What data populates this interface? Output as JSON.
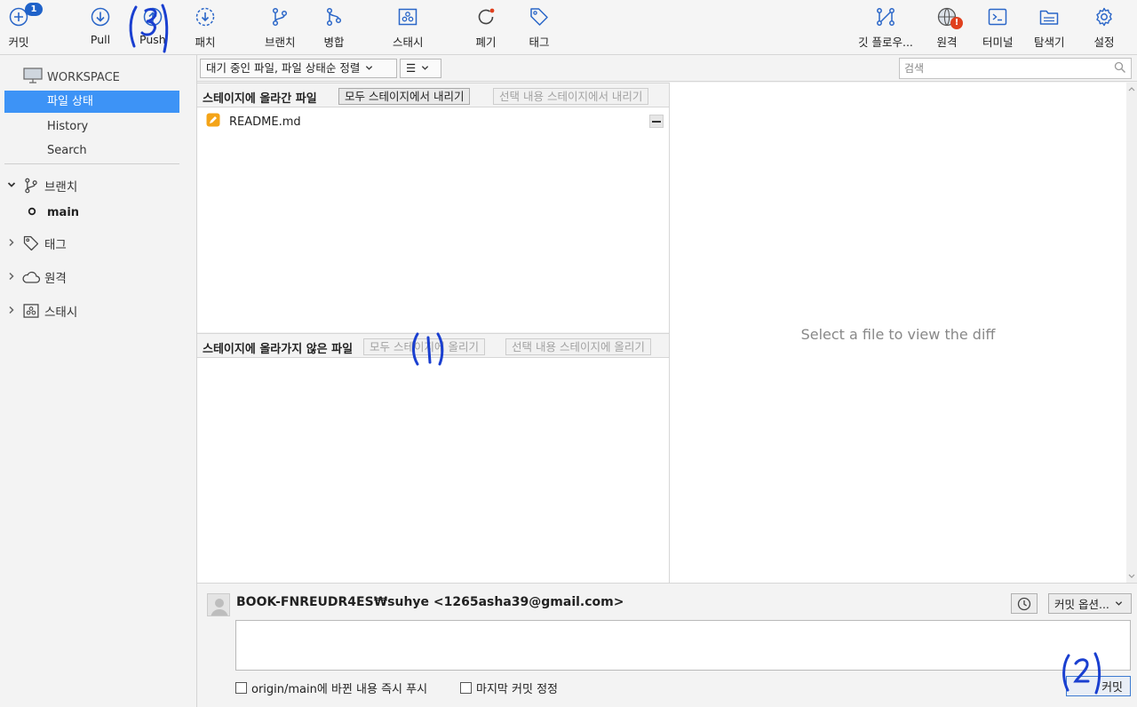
{
  "toolbar": {
    "commit": {
      "label": "커밋",
      "badge": "1"
    },
    "pull": {
      "label": "Pull"
    },
    "push": {
      "label": "Push"
    },
    "fetch": {
      "label": "패치"
    },
    "branch": {
      "label": "브랜치"
    },
    "merge": {
      "label": "병합"
    },
    "stash": {
      "label": "스태시"
    },
    "discard": {
      "label": "폐기"
    },
    "tag": {
      "label": "태그"
    },
    "gitflow": {
      "label": "깃 플로우..."
    },
    "remote": {
      "label": "원격",
      "warning": "!"
    },
    "terminal": {
      "label": "터미널"
    },
    "explorer": {
      "label": "탐색기"
    },
    "settings": {
      "label": "설정"
    }
  },
  "sidebar": {
    "workspace": "WORKSPACE",
    "items": [
      {
        "label": "파일 상태"
      },
      {
        "label": "History"
      },
      {
        "label": "Search"
      }
    ],
    "branches": {
      "label": "브랜치",
      "current": "main"
    },
    "tags": {
      "label": "태그"
    },
    "remotes": {
      "label": "원격"
    },
    "stashes": {
      "label": "스태시"
    }
  },
  "filter": {
    "status_dropdown": "대기 중인 파일, 파일 상태순 정렬",
    "view_dropdown": "☰",
    "search_placeholder": "검색"
  },
  "staged": {
    "title": "스테이지에 올라간 파일",
    "unstage_all": "모두 스테이지에서 내리기",
    "unstage_selected": "선택 내용 스테이지에서 내리기",
    "files": [
      {
        "name": "README.md"
      }
    ]
  },
  "unstaged": {
    "title": "스테이지에 올라가지 않은 파일",
    "stage_all": "모두 스테이지에 올리기",
    "stage_selected": "선택 내용 스테이지에 올리기"
  },
  "diff": {
    "empty_message": "Select a file to view the diff"
  },
  "commit": {
    "author": "BOOK-FNREUDR4ES₩suhye <1265asha39@gmail.com>",
    "options": "커밋 옵션...",
    "push_checkbox": "origin/main에 바뀐 내용 즉시 푸시",
    "amend_checkbox": "마지막 커밋 정정",
    "commit_button": "커밋"
  },
  "annotations": {
    "one": "(1)",
    "two": "(2)",
    "three": "(3)"
  },
  "colors": {
    "accent": "#3d93f6",
    "badge": "#1f62c9",
    "warning": "#e0401e",
    "pen": "#1a3fd0"
  }
}
